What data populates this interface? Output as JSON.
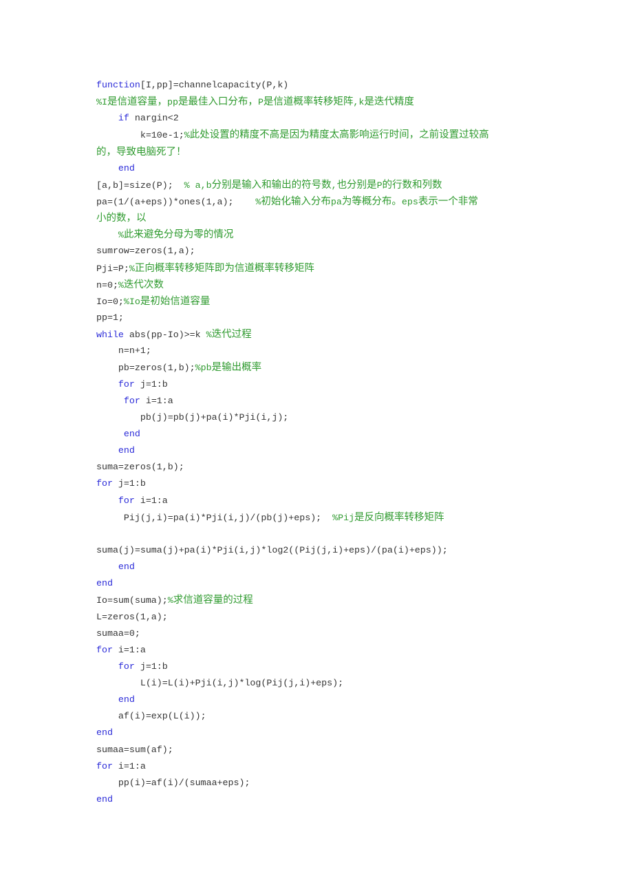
{
  "document": {
    "language": "MATLAB",
    "colors": {
      "keyword": "#2a2ad8",
      "comment": "#2e9a2e",
      "code": "#333333",
      "background": "#ffffff"
    },
    "lines": [
      {
        "indent": "",
        "kw": "function",
        "code": "[I,pp]=channelcapacity(P,k)",
        "comment": ""
      },
      {
        "indent": "",
        "kw": "",
        "code": "",
        "comment": "%I是信道容量，pp是最佳入口分布，P是信道概率转移矩阵,k是迭代精度"
      },
      {
        "indent": "    ",
        "kw": "if",
        "code": " nargin<2",
        "comment": ""
      },
      {
        "indent": "        ",
        "kw": "",
        "code": "k=10e-1;",
        "comment": "%此处设置的精度不高是因为精度太高影响运行时间，之前设置过较高"
      },
      {
        "indent": "",
        "kw": "",
        "code": "",
        "comment": "的，导致电脑死了！"
      },
      {
        "indent": "    ",
        "kw": "end",
        "code": "",
        "comment": ""
      },
      {
        "indent": "",
        "kw": "",
        "code": "[a,b]=size(P);  ",
        "comment": "% a,b分别是输入和输出的符号数,也分别是P的行数和列数"
      },
      {
        "indent": "",
        "kw": "",
        "code": "pa=(1/(a+eps))*ones(1,a);    ",
        "comment": "%初始化输入分布pa为等概分布。eps表示一个非常"
      },
      {
        "indent": "",
        "kw": "",
        "code": "",
        "comment": "小的数，以"
      },
      {
        "indent": "    ",
        "kw": "",
        "code": "",
        "comment": "%此来避免分母为零的情况"
      },
      {
        "indent": "",
        "kw": "",
        "code": "sumrow=zeros(1,a);",
        "comment": ""
      },
      {
        "indent": "",
        "kw": "",
        "code": "Pji=P;",
        "comment": "%正向概率转移矩阵即为信道概率转移矩阵"
      },
      {
        "indent": "",
        "kw": "",
        "code": "n=0;",
        "comment": "%迭代次数"
      },
      {
        "indent": "",
        "kw": "",
        "code": "Io=0;",
        "comment": "%Io是初始信道容量"
      },
      {
        "indent": "",
        "kw": "",
        "code": "pp=1;",
        "comment": ""
      },
      {
        "indent": "",
        "kw": "while",
        "code": " abs(pp-Io)>=k ",
        "comment": "%迭代过程"
      },
      {
        "indent": "    ",
        "kw": "",
        "code": "n=n+1;",
        "comment": ""
      },
      {
        "indent": "    ",
        "kw": "",
        "code": "pb=zeros(1,b);",
        "comment": "%pb是输出概率"
      },
      {
        "indent": "    ",
        "kw": "for",
        "code": " j=1:b",
        "comment": ""
      },
      {
        "indent": "     ",
        "kw": "for",
        "code": " i=1:a",
        "comment": ""
      },
      {
        "indent": "        ",
        "kw": "",
        "code": "pb(j)=pb(j)+pa(i)*Pji(i,j);",
        "comment": ""
      },
      {
        "indent": "     ",
        "kw": "end",
        "code": "",
        "comment": ""
      },
      {
        "indent": "    ",
        "kw": "end",
        "code": "",
        "comment": ""
      },
      {
        "indent": "",
        "kw": "",
        "code": "suma=zeros(1,b);",
        "comment": ""
      },
      {
        "indent": "",
        "kw": "for",
        "code": " j=1:b",
        "comment": ""
      },
      {
        "indent": "    ",
        "kw": "for",
        "code": " i=1:a",
        "comment": ""
      },
      {
        "indent": "     ",
        "kw": "",
        "code": "Pij(j,i)=pa(i)*Pji(i,j)/(pb(j)+eps);  ",
        "comment": "%Pij是反向概率转移矩阵"
      },
      {
        "indent": "",
        "kw": "",
        "code": "",
        "comment": ""
      },
      {
        "indent": "",
        "kw": "",
        "code": "suma(j)=suma(j)+pa(i)*Pji(i,j)*log2((Pij(j,i)+eps)/(pa(i)+eps));",
        "comment": ""
      },
      {
        "indent": "    ",
        "kw": "end",
        "code": "",
        "comment": ""
      },
      {
        "indent": "",
        "kw": "end",
        "code": "",
        "comment": ""
      },
      {
        "indent": "",
        "kw": "",
        "code": "Io=sum(suma);",
        "comment": "%求信道容量的过程"
      },
      {
        "indent": "",
        "kw": "",
        "code": "L=zeros(1,a);",
        "comment": ""
      },
      {
        "indent": "",
        "kw": "",
        "code": "sumaa=0;",
        "comment": ""
      },
      {
        "indent": "",
        "kw": "for",
        "code": " i=1:a",
        "comment": ""
      },
      {
        "indent": "    ",
        "kw": "for",
        "code": " j=1:b",
        "comment": ""
      },
      {
        "indent": "        ",
        "kw": "",
        "code": "L(i)=L(i)+Pji(i,j)*log(Pij(j,i)+eps);",
        "comment": ""
      },
      {
        "indent": "    ",
        "kw": "end",
        "code": "",
        "comment": ""
      },
      {
        "indent": "    ",
        "kw": "",
        "code": "af(i)=exp(L(i));",
        "comment": ""
      },
      {
        "indent": "",
        "kw": "end",
        "code": "",
        "comment": ""
      },
      {
        "indent": "",
        "kw": "",
        "code": "sumaa=sum(af);",
        "comment": ""
      },
      {
        "indent": "",
        "kw": "for",
        "code": " i=1:a",
        "comment": ""
      },
      {
        "indent": "    ",
        "kw": "",
        "code": "pp(i)=af(i)/(sumaa+eps);",
        "comment": ""
      },
      {
        "indent": "",
        "kw": "end",
        "code": "",
        "comment": ""
      }
    ]
  }
}
